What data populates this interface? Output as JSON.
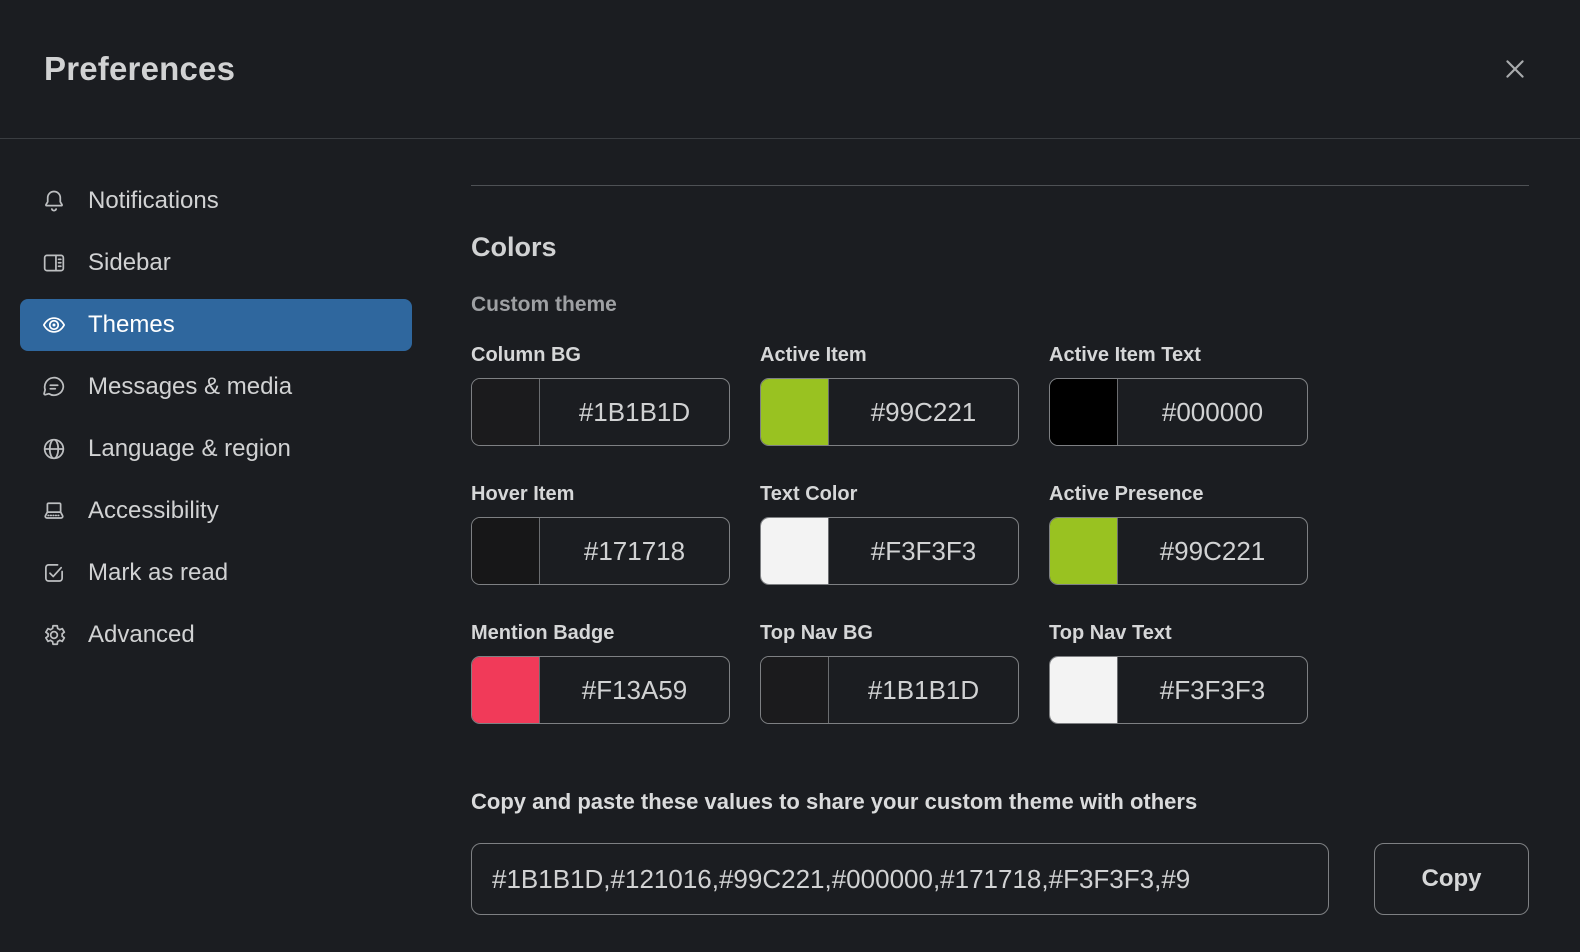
{
  "window": {
    "title": "Preferences"
  },
  "sidebar": {
    "active_bg": "#2F679E",
    "items": [
      {
        "label": "Notifications",
        "icon": "bell",
        "active": false
      },
      {
        "label": "Sidebar",
        "icon": "sidebar",
        "active": false
      },
      {
        "label": "Themes",
        "icon": "eye",
        "active": true
      },
      {
        "label": "Messages & media",
        "icon": "message",
        "active": false
      },
      {
        "label": "Language & region",
        "icon": "globe",
        "active": false
      },
      {
        "label": "Accessibility",
        "icon": "keyboard",
        "active": false
      },
      {
        "label": "Mark as read",
        "icon": "check-square",
        "active": false
      },
      {
        "label": "Advanced",
        "icon": "gear",
        "active": false
      }
    ]
  },
  "main": {
    "section_title": "Colors",
    "subsection_title": "Custom theme",
    "color_fields": [
      {
        "label": "Column BG",
        "value": "#1B1B1D",
        "swatch": "#1B1B1D"
      },
      {
        "label": "Active Item",
        "value": "#99C221",
        "swatch": "#99C221"
      },
      {
        "label": "Active Item Text",
        "value": "#000000",
        "swatch": "#000000"
      },
      {
        "label": "Hover Item",
        "value": "#171718",
        "swatch": "#171718"
      },
      {
        "label": "Text Color",
        "value": "#F3F3F3",
        "swatch": "#F3F3F3"
      },
      {
        "label": "Active Presence",
        "value": "#99C221",
        "swatch": "#99C221"
      },
      {
        "label": "Mention Badge",
        "value": "#F13A59",
        "swatch": "#F13A59"
      },
      {
        "label": "Top Nav BG",
        "value": "#1B1B1D",
        "swatch": "#1B1B1D"
      },
      {
        "label": "Top Nav Text",
        "value": "#F3F3F3",
        "swatch": "#F3F3F3"
      }
    ],
    "share": {
      "instruction": "Copy and paste these values to share your custom theme with others",
      "value": "#1B1B1D,#121016,#99C221,#000000,#171718,#F3F3F3,#9",
      "copy_label": "Copy"
    }
  }
}
